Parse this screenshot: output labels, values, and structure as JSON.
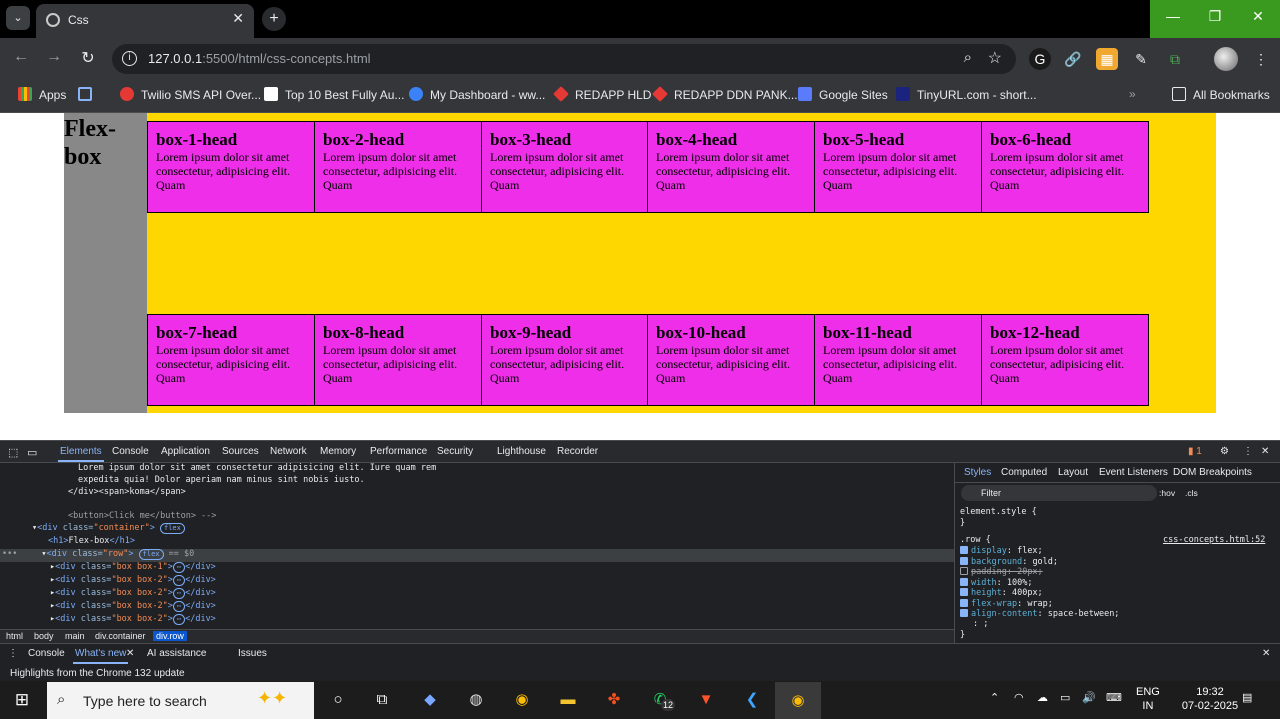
{
  "browser": {
    "tab_title": "Css",
    "url_host": "127.0.0.1",
    "url_rest": ":5500/html/css-concepts.html",
    "bookmarks": [
      {
        "label": "Apps",
        "color": "#e2a52b"
      },
      {
        "label": "",
        "color": "#8ab4f8"
      },
      {
        "label": "Twilio SMS API Over...",
        "color": "#e53935"
      },
      {
        "label": "Top 10 Best Fully Au...",
        "color": "#ffffff"
      },
      {
        "label": "My Dashboard - ww...",
        "color": "#3b82f6"
      },
      {
        "label": "REDAPP HLD",
        "color": "#e53935"
      },
      {
        "label": "REDAPP DDN PANK...",
        "color": "#e53935"
      },
      {
        "label": "Google Sites",
        "color": "#5b7cfa"
      },
      {
        "label": "TinyURL.com - short...",
        "color": "#1a237e"
      }
    ],
    "all_bookmarks": "All Bookmarks"
  },
  "page": {
    "heading": "Flex-box",
    "box_text": "Lorem ipsum dolor sit amet consectetur, adipisicing elit. Quam",
    "boxes": [
      "box-1-head",
      "box-2-head",
      "box-3-head",
      "box-4-head",
      "box-5-head",
      "box-6-head",
      "box-7-head",
      "box-8-head",
      "box-9-head",
      "box-10-head",
      "box-11-head",
      "box-12-head"
    ],
    "colors": {
      "row_bg": "#ffd700",
      "box_bg": "#ee2ee8",
      "container_bg": "#888888"
    }
  },
  "devtools": {
    "tabs": [
      "Elements",
      "Console",
      "Application",
      "Sources",
      "Network",
      "Memory",
      "Performance",
      "Security",
      "Lighthouse",
      "Recorder"
    ],
    "issues_count": "1",
    "dom_lines": [
      "Lorem ipsum dolor sit amet consectetur adipisicing elit. Iure quam rem",
      "expedita quia! Dolor aperiam nam minus sint nobis iusto.",
      "</div><span>koma</span>",
      "<button>Click me</button> -->"
    ],
    "container_class": "container",
    "h1_text": "Flex-box",
    "row_class": "row",
    "dollar_zero": "== $0",
    "flex_badge": "flex",
    "child_classes": [
      "box box-1",
      "box box-2",
      "box box-2",
      "box box-2",
      "box box-2"
    ],
    "breadcrumbs": [
      "html",
      "body",
      "main",
      "div.container",
      "div.row"
    ],
    "styles_tabs": [
      "Styles",
      "Computed",
      "Layout",
      "Event Listeners",
      "DOM Breakpoints"
    ],
    "filter_placeholder": "Filter",
    "hov": ":hov",
    "cls": ".cls",
    "element_style": "element.style {",
    "rule_selector": ".row {",
    "rule_source": "css-concepts.html:52",
    "declarations": [
      {
        "prop": "display",
        "value": "flex;",
        "on": true,
        "strike": false
      },
      {
        "prop": "background",
        "value": "gold;",
        "on": true,
        "strike": false
      },
      {
        "prop": "padding",
        "value": "20px;",
        "on": false,
        "strike": true
      },
      {
        "prop": "width",
        "value": "100%;",
        "on": true,
        "strike": false
      },
      {
        "prop": "height",
        "value": "400px;",
        "on": true,
        "strike": false
      },
      {
        "prop": "flex-wrap",
        "value": "wrap;",
        "on": true,
        "strike": false
      },
      {
        "prop": "align-content",
        "value": "space-between;",
        "on": true,
        "strike": false
      }
    ],
    "drawer_tabs": [
      "Console",
      "What's new",
      "AI assistance",
      "Issues"
    ],
    "drawer_message": "Highlights from the Chrome 132 update"
  },
  "taskbar": {
    "search_placeholder": "Type here to search",
    "lang_top": "ENG",
    "lang_bottom": "IN",
    "time": "19:32",
    "date": "07-02-2025",
    "whatsapp_badge": "12"
  }
}
